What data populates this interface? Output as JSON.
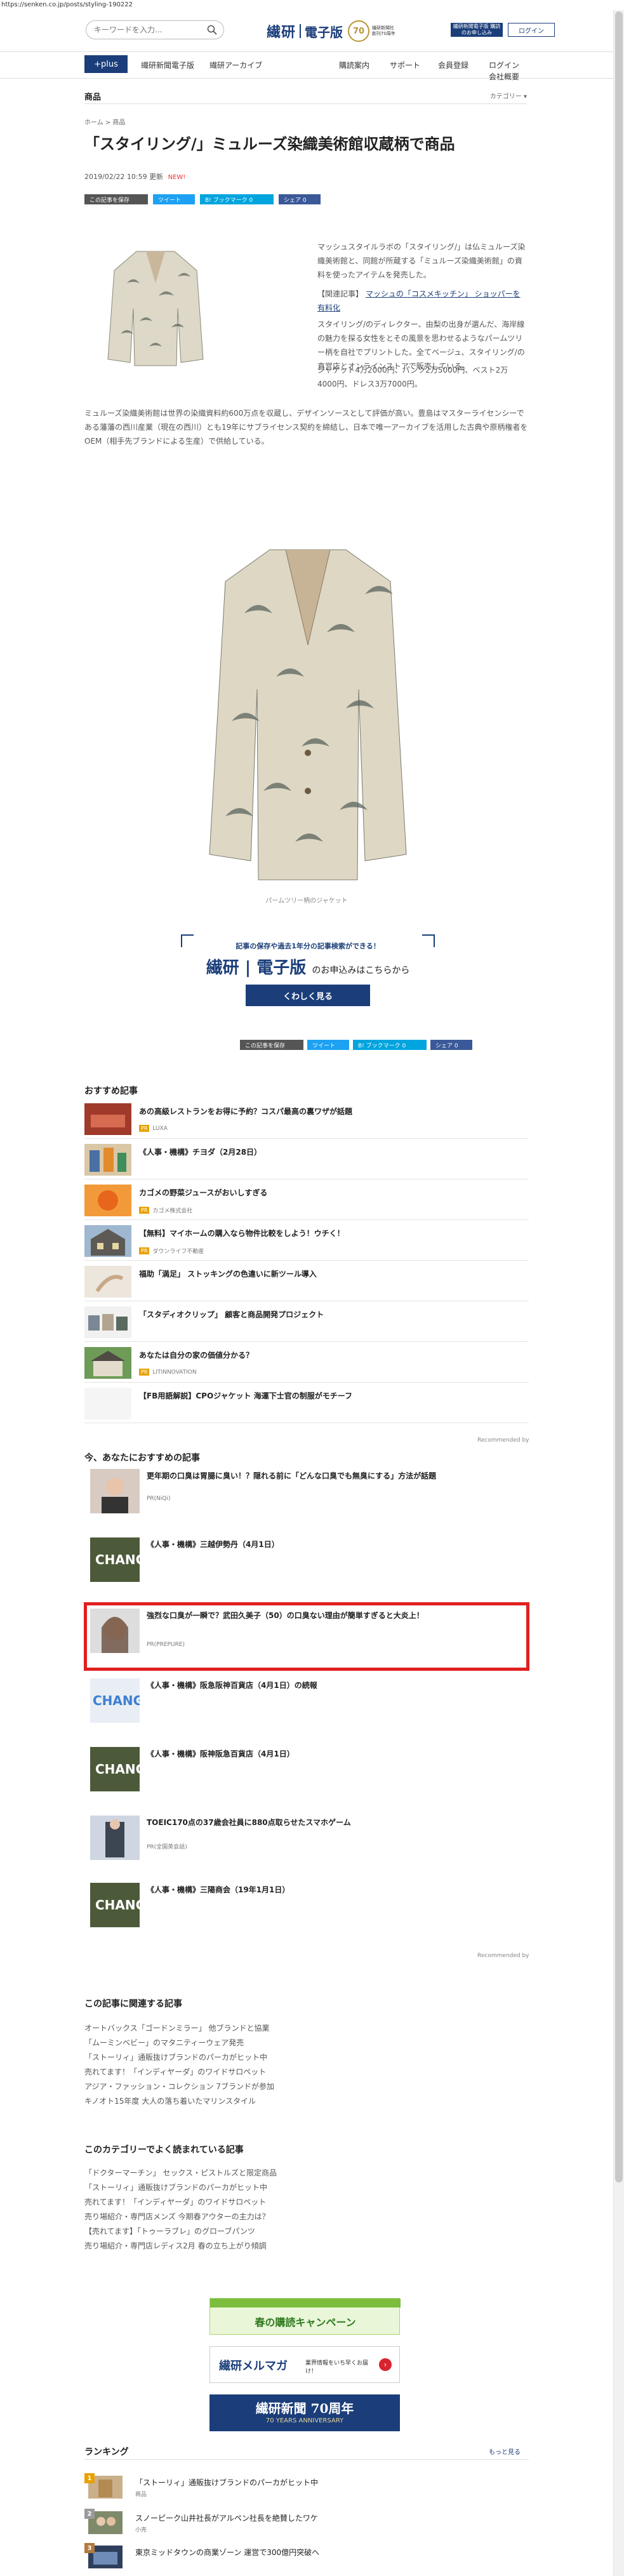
{
  "browser": {
    "url": "https://senken.co.jp/posts/styling-190222"
  },
  "header": {
    "search_placeholder": "キーワードを入力...",
    "logo_main": "繊研",
    "logo_sub": "電子版",
    "anniversary": "70",
    "anniversary_text": "繊研新聞社創刊70周年",
    "banner_text": "繊研新聞電子版 購読のお申し込み",
    "login_label": "ログイン"
  },
  "nav": {
    "plus_label": "+plus",
    "links": [
      "繊研新聞電子版",
      "繊研アーカイブ"
    ],
    "right_links": [
      "購読案内",
      "サポート",
      "会員登録",
      "ログイン"
    ],
    "company": "会社概要"
  },
  "category": {
    "label": "商品",
    "selector": "カテゴリー ▾"
  },
  "breadcrumb": "ホーム > 商品",
  "article": {
    "title": "「スタイリング/」ミュルーズ染織美術館収蔵柄で商品",
    "date": "2019/02/22 10:59 更新",
    "new_label": "NEW!",
    "share": {
      "save": "この記事を保存",
      "tweet": "ツイート",
      "hatena": "B! ブックマーク 0",
      "facebook": "シェア 0"
    },
    "p1": "マッシュスタイルラボの「スタイリング/」は仏ミュルーズ染織美術館と、同館が所蔵する「ミュルーズ染織美術館」の資料を使ったアイテムを発売した。",
    "p2_prefix": "【関連記事】",
    "p2_link": "マッシュの「コスメキッチン」 ショッパーを有料化",
    "p3": "スタイリング/のディレクター、由梨の出身が選んだ、海岸線の魅力を探る女性をとその風景を思わせるようなパームツリー柄を自社でプリントした。全てベージュ、スタイリング/の直営店とオンラインストアで販売している。",
    "p4": "ジャケット4万2000円、パンツ2万5000円、ベスト2万4000円、ドレス3万7000円。",
    "p5": "ミュルーズ染織美術館は世界の染織資料約600万点を収蔵し、デザインソースとして評価が高い。豊島はマスターライセンシーである藩藩の西川産業（現在の西川）とも19年にサブライセンス契約を締結し、日本で唯一アーカイブを活用した古典や原柄権者をOEM（相手先ブランドによる生産）で供給している。",
    "caption": "パームツリー柄のジャケット"
  },
  "promo": {
    "headline": "記事の保存や過去1年分の記事検索ができる！",
    "logo": "繊研",
    "logo_sub": "電子版",
    "tail": "のお申込みはこちらから",
    "button": "くわしく見る"
  },
  "recommended": {
    "heading": "おすすめ記事",
    "items": [
      {
        "title": "あの高級レストランをお得に予約？コスパ最高の裏ワザが話題",
        "sponsor": "LUXA",
        "pr": "PR"
      },
      {
        "title": "《人事・機構》チヨダ（2月28日）",
        "sponsor": "",
        "pr": ""
      },
      {
        "title": "カゴメの野菜ジュースがおいしすぎる",
        "sponsor": "カゴメ株式会社",
        "pr": "PR"
      },
      {
        "title": "【無料】マイホームの購入なら物件比較をしよう！ウチく！",
        "sponsor": "ダウンライフ不動産",
        "pr": "PR"
      },
      {
        "title": "福助「満足」 ストッキングの色違いに新ツール導入",
        "sponsor": "",
        "pr": ""
      },
      {
        "title": "「スタディオクリップ」 顧客と商品開発プロジェクト",
        "sponsor": "",
        "pr": ""
      },
      {
        "title": "あなたは自分の家の価値分かる？",
        "sponsor": "LITINNOVATION",
        "pr": "PR"
      },
      {
        "title": "【FB用語解説】CPOジャケット 海運下士官の制服がモチーフ",
        "sponsor": "",
        "pr": ""
      }
    ],
    "recommended_by": "Recommended by"
  },
  "now_recommended": {
    "heading": "今、あなたにおすすめの記事",
    "items": [
      {
        "title": "更年期の口臭は胃腸に臭い！？隠れる前に「どんな口臭でも無臭にする」方法が話題",
        "src": "PR(NiQi)"
      },
      {
        "title": "《人事・機構》三越伊勢丹（4月1日）",
        "src": ""
      },
      {
        "title": "強烈な口臭が一瞬で？武田久美子（50）の口臭ない理由が簡単すぎると大炎上！",
        "src": "PR(PREPURE)"
      },
      {
        "title": "《人事・機構》阪急阪神百貨店（4月1日）の続報",
        "src": ""
      },
      {
        "title": "《人事・機構》阪神阪急百貨店（4月1日）",
        "src": ""
      },
      {
        "title": "TOEIC170点の37歳会社員に880点取らせたスマホゲーム",
        "src": "PR(全国英会話)"
      },
      {
        "title": "《人事・機構》三陽商会（19年1月1日）",
        "src": ""
      }
    ],
    "recommended_by": "Recommended by"
  },
  "related": {
    "heading": "この記事に関連する記事",
    "links": [
      "オートバックス「ゴードンミラー」 他ブランドと協業",
      "「ムーミンベビー」のマタニティーウェア発売",
      "「ストーリィ」通販抜けブランドのパーカがヒット中",
      "売れてます！「インディヤーダ」のワイドサロペット",
      "アジア・ファッション・コレクション 7ブランドが参加",
      "キノオト15年度 大人の落ち着いたマリンスタイル"
    ]
  },
  "popular": {
    "heading": "このカテゴリーでよく読まれている記事",
    "links": [
      "「ドクターマーチン」 セックス・ピストルズと限定商品",
      "「ストーリィ」通販抜けブランドのパーカがヒット中",
      "売れてます！「インディヤーダ」のワイドサロペット",
      "売り場紹介・専門店メンズ 今期春アウターの主力は？",
      "【売れてます】「トゥーラブレ」のグローブパンツ",
      "売り場紹介・専門店レディス2月 春の立ち上がり傾調"
    ]
  },
  "banners": {
    "campaign": "春の購読キャンペーン",
    "mailmag": "繊研メルマガ",
    "mailmag_sub": "業界情報をいち早くお届け！",
    "anniv": "繊研新聞 70周年",
    "anniv_en": "70 YEARS ANNIVERSARY"
  },
  "ranking": {
    "heading": "ランキング",
    "more": "もっと見る",
    "items": [
      {
        "rank": "1",
        "title": "「ストーリィ」通販抜けブランドのパーカがヒット中",
        "tag": "商品"
      },
      {
        "rank": "2",
        "title": "スノーピーク山井社長がアルペン社長を絶賛したワケ",
        "tag": "小売"
      },
      {
        "rank": "3",
        "title": "東京ミッドタウンの商業ゾーン 運営で300億円突破へ",
        "tag": ""
      }
    ]
  }
}
